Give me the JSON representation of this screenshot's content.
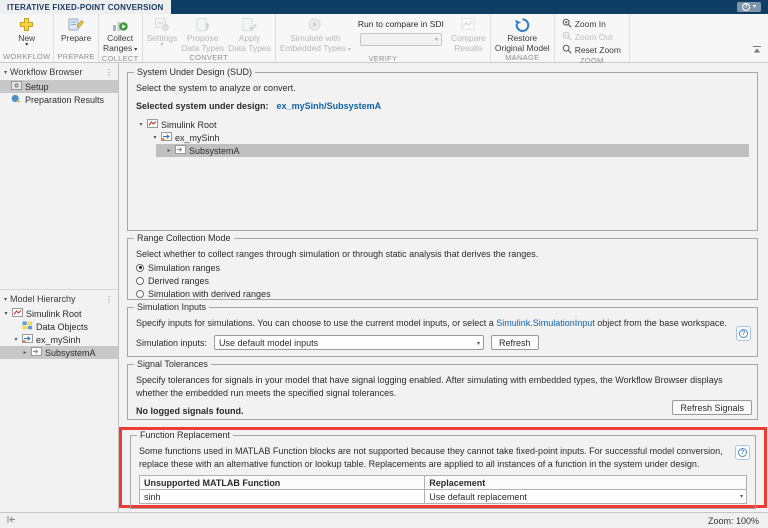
{
  "icons": {
    "caret_down": "▾",
    "tree_expanded": "▾",
    "tree_collapsed": "▸",
    "panel_menu": "⋮",
    "help": "?"
  },
  "colors": {
    "titlebar": "#0e3d65",
    "link": "#0f62a8",
    "highlight_red": "#ee3b34",
    "selection_gray": "#c8c8c8"
  },
  "window": {
    "tab_title": "ITERATIVE FIXED-POINT CONVERSION"
  },
  "ribbon": {
    "workflow": {
      "section": "WORKFLOW",
      "new": "New"
    },
    "prepare": {
      "section": "PREPARE",
      "button": "Prepare"
    },
    "collect": {
      "section": "COLLECT",
      "button_lines": [
        "Collect",
        "Ranges"
      ]
    },
    "convert": {
      "section": "CONVERT",
      "settings": "Settings",
      "propose_lines": [
        "Propose",
        "Data Types"
      ],
      "apply_lines": [
        "Apply",
        "Data Types"
      ]
    },
    "verify": {
      "section": "VERIFY",
      "simulate_lines": [
        "Simulate with",
        "Embedded Types"
      ],
      "run_to_compare": "Run to compare in SDI",
      "compare_lines": [
        "Compare",
        "Results"
      ]
    },
    "manage": {
      "section": "MANAGE",
      "restore_lines": [
        "Restore",
        "Original Model"
      ]
    },
    "zoom": {
      "section": "ZOOM",
      "zoom_in": "Zoom In",
      "zoom_out": "Zoom Out",
      "reset_zoom": "Reset Zoom"
    }
  },
  "sidebar": {
    "workflow_browser": {
      "title": "Workflow Browser",
      "items": [
        {
          "label": "Setup"
        },
        {
          "label": "Preparation Results"
        }
      ],
      "selected": "Setup"
    },
    "model_hierarchy": {
      "title": "Model Hierarchy",
      "items": [
        {
          "label": "Simulink Root"
        },
        {
          "label": "Data Objects"
        },
        {
          "label": "ex_mySinh"
        },
        {
          "label": "SubsystemA"
        }
      ],
      "selected": "SubsystemA"
    }
  },
  "main": {
    "sud": {
      "title": "System Under Design (SUD)",
      "description": "Select the system to analyze or convert.",
      "selected_label": "Selected system under design:",
      "selected_value": "ex_mySinh/SubsystemA",
      "tree": [
        {
          "label": "Simulink Root"
        },
        {
          "label": "ex_mySinh"
        },
        {
          "label": "SubsystemA"
        }
      ],
      "tree_selected": "SubsystemA"
    },
    "range_collection": {
      "title": "Range Collection Mode",
      "description": "Select whether to collect ranges through simulation or through static analysis that derives the ranges.",
      "options": [
        "Simulation ranges",
        "Derived ranges",
        "Simulation with derived ranges"
      ],
      "selected": "Simulation ranges"
    },
    "simulation_inputs": {
      "title": "Simulation Inputs",
      "description_prefix": "Specify inputs for simulations. You can choose to use the current model inputs, or select a ",
      "description_link": "Simulink.SimulationInput",
      "description_suffix": " object from the base workspace.",
      "input_label": "Simulation inputs:",
      "input_value": "Use default model inputs",
      "refresh_button": "Refresh"
    },
    "signal_tolerances": {
      "title": "Signal Tolerances",
      "description": "Specify tolerances for signals in your model that have signal logging enabled. After simulating with embedded types, the Workflow Browser displays whether the embedded run meets the specified signal tolerances.",
      "status": "No logged signals found.",
      "refresh_button": "Refresh Signals"
    },
    "function_replacement": {
      "title": "Function Replacement",
      "description": "Some functions used in MATLAB Function blocks are not supported because they cannot take fixed-point inputs. For successful model conversion, replace these with an alternative function or lookup table. Replacements are applied to all instances of a function in the system under design.",
      "headers": [
        "Unsupported MATLAB Function",
        "Replacement"
      ],
      "rows": [
        {
          "function": "sinh",
          "replacement": "Use default replacement"
        }
      ]
    }
  },
  "statusbar": {
    "zoom": "Zoom: 100%"
  }
}
